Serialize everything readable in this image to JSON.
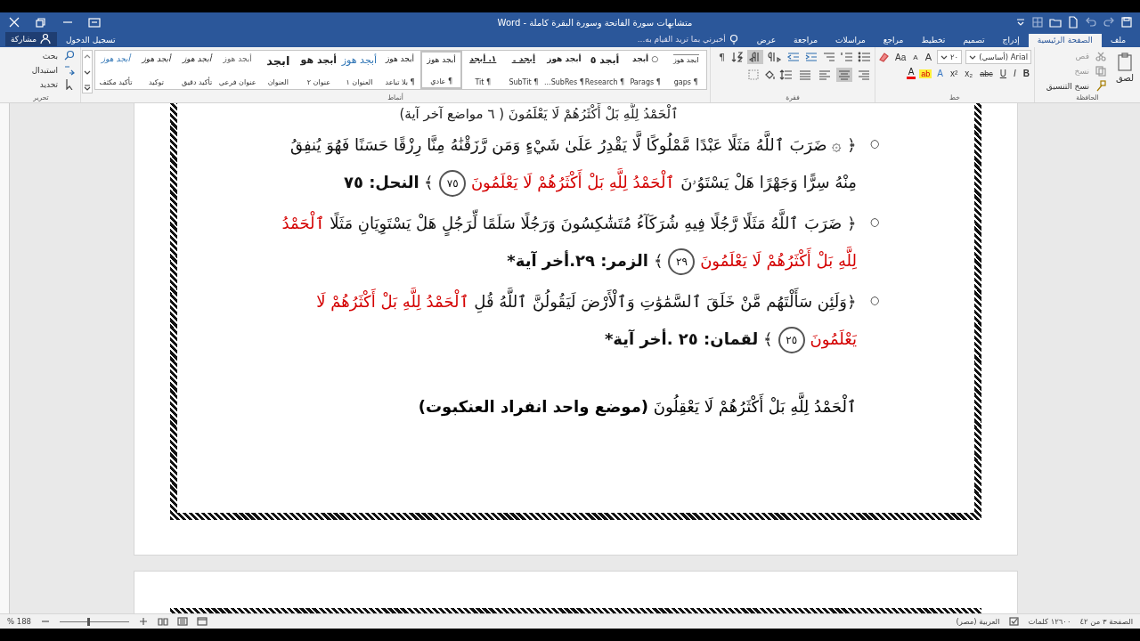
{
  "title_bar": {
    "title": "متشابهات سورة الفاتحة وسورة البقرة كاملة - Word"
  },
  "tabs": [
    {
      "label": "ملف",
      "selected": false
    },
    {
      "label": "الصفحة الرئيسية",
      "selected": true
    },
    {
      "label": "إدراج",
      "selected": false
    },
    {
      "label": "تصميم",
      "selected": false
    },
    {
      "label": "تخطيط",
      "selected": false
    },
    {
      "label": "مراجع",
      "selected": false
    },
    {
      "label": "مراسلات",
      "selected": false
    },
    {
      "label": "مراجعة",
      "selected": false
    },
    {
      "label": "عرض",
      "selected": false
    }
  ],
  "tell_me": {
    "placeholder": "أخبرني بما تريد القيام به..."
  },
  "account": {
    "sign_in": "تسجيل الدخول",
    "share": "مشاركة"
  },
  "ribbon": {
    "clipboard": {
      "label": "الحافظة",
      "paste": "لصق",
      "cut": "قص",
      "copy": "نسخ",
      "format_painter": "نسخ التنسيق"
    },
    "font": {
      "label": "خط",
      "font_name": "Arial (أساسي)",
      "font_size": "٢٠",
      "top_buttons": [
        {
          "label": "A",
          "kind": "grow"
        },
        {
          "label": "A",
          "kind": "shrink"
        },
        {
          "label": "Aa",
          "kind": "case"
        }
      ],
      "bottom_buttons": [
        {
          "label": "B",
          "kind": "bold"
        },
        {
          "label": "I",
          "kind": "italic"
        },
        {
          "label": "U",
          "kind": "underline"
        },
        {
          "label": "abc",
          "kind": "strike"
        },
        {
          "label": "x₂",
          "kind": "plain"
        },
        {
          "label": "x²",
          "kind": "plain"
        },
        {
          "label": "A",
          "kind": "effects"
        },
        {
          "label": "ab",
          "kind": "highlight"
        },
        {
          "label": "A",
          "kind": "color"
        }
      ]
    },
    "paragraph": {
      "label": "فقرة",
      "pilcrow": "¶",
      "direction": [
        {
          "kind": "ltr",
          "selected": false
        },
        {
          "kind": "rtl",
          "selected": true
        }
      ],
      "alignment": [
        {
          "kind": "right",
          "selected": false
        },
        {
          "kind": "center",
          "selected": true
        },
        {
          "kind": "left",
          "selected": false
        },
        {
          "kind": "justify",
          "selected": false
        }
      ]
    },
    "styles": {
      "label": "أنماط",
      "items": [
        {
          "preview": "ابجد هوز",
          "name": "¶ gaps",
          "kind": "tiny",
          "selected": false
        },
        {
          "preview": "○ أبجد",
          "name": "¶ Parags",
          "kind": "bold",
          "selected": false
        },
        {
          "preview": "أبجد ٥",
          "name": "¶ Research",
          "kind": "heavy",
          "selected": false
        },
        {
          "preview": "أبجد هوز",
          "name": "¶ SubRes...",
          "kind": "bold",
          "selected": false
        },
        {
          "preview": "أبجد ۔",
          "name": "¶ SubTit",
          "kind": "underline",
          "selected": false
        },
        {
          "preview": "١. أبجد",
          "name": "¶ Tit",
          "kind": "underline",
          "selected": false
        },
        {
          "preview": "أبجد هوز",
          "name": "¶ عادي",
          "kind": "plain",
          "selected": true
        },
        {
          "preview": "أبجد هوز",
          "name": "¶ بلا تباعد",
          "kind": "plain",
          "selected": false
        },
        {
          "preview": "أبجد هوز",
          "name": "العنوان ١",
          "kind": "heading",
          "selected": false
        },
        {
          "preview": "أبجد هو",
          "name": "عنوان ٢",
          "kind": "heavy",
          "selected": false
        },
        {
          "preview": "ابجد",
          "name": "العنوان",
          "kind": "title",
          "selected": false
        },
        {
          "preview": "أبجد هوز",
          "name": "عنوان فرعي",
          "kind": "subtle",
          "selected": false
        },
        {
          "preview": "أبجد هوز",
          "name": "تأكيد دقيق",
          "kind": "italic",
          "selected": false
        },
        {
          "preview": "أبجد هوز",
          "name": "توكيد",
          "kind": "italic",
          "selected": false
        },
        {
          "preview": "أبجد هوز",
          "name": "تأكيد مكثف",
          "kind": "intense",
          "selected": false
        }
      ]
    },
    "editing": {
      "label": "تحرير",
      "find": "بحث",
      "replace": "استبدال",
      "select": "تحديد"
    }
  },
  "document": {
    "top_line": "ٱلْحَمْدُ لِلَّهِ بَلْ أَكْثَرُهُمْ لَا يَعْلَمُونَ ( ٦ مواضع آخر آية)",
    "items": [
      {
        "bullet": "○",
        "segments": [
          {
            "kind": "quran",
            "text": "﴿ ۞ ضَرَبَ ٱللَّهُ مَثَلًا عَبْدًا مَّمْلُوكًا لَّا يَقْدِرُ عَلَىٰ شَيْءٍ وَمَن رَّزَقْنَٰهُ مِنَّا رِزْقًا حَسَنًا فَهُوَ يُنفِقُ مِنْهُ سِرًّا وَجَهْرًا هَلْ يَسْتَوُۥنَ"
          },
          {
            "kind": "highlight",
            "text": "ٱلْحَمْدُ لِلَّهِ بَلْ أَكْثَرُهُمْ لَا يَعْلَمُونَ"
          },
          {
            "kind": "ayah_number",
            "text": "٧٥"
          },
          {
            "kind": "quran",
            "text": "﴾"
          },
          {
            "kind": "reference",
            "text": "النحل: ٧٥"
          }
        ]
      },
      {
        "bullet": "○",
        "segments": [
          {
            "kind": "quran",
            "text": "﴿ ضَرَبَ ٱللَّهُ مَثَلًا رَّجُلًا فِيهِ شُرَكَآءُ مُتَشَٰكِسُونَ وَرَجُلًا سَلَمًا لِّرَجُلٍ هَلْ يَسْتَوِيَانِ مَثَلًا"
          },
          {
            "kind": "highlight",
            "text": "ٱلْحَمْدُ لِلَّهِ بَلْ أَكْثَرُهُمْ لَا يَعْلَمُونَ"
          },
          {
            "kind": "ayah_number",
            "text": "٢٩"
          },
          {
            "kind": "quran",
            "text": "﴾"
          },
          {
            "kind": "reference",
            "text": "الزمر: ٢٩.أخر آية*"
          }
        ]
      },
      {
        "bullet": "○",
        "segments": [
          {
            "kind": "quran",
            "text": "﴿وَلَئِن سَأَلْتَهُم مَّنْ خَلَقَ ٱلسَّمَٰوَٰتِ وَٱلْأَرْضَ لَيَقُولُنَّ ٱللَّهُ قُلِ"
          },
          {
            "kind": "highlight",
            "text": "ٱلْحَمْدُ لِلَّهِ بَلْ أَكْثَرُهُمْ لَا يَعْلَمُونَ"
          },
          {
            "kind": "ayah_number",
            "text": "٢٥"
          },
          {
            "kind": "quran",
            "text": "﴾"
          },
          {
            "kind": "reference",
            "text": "لقمان: ٢٥ .أخر آية*"
          }
        ]
      }
    ],
    "closing": {
      "verse": "ٱلْحَمْدُ لِلَّهِ بَلْ أَكْثَرُهُمْ لَا يَعْقِلُونَ",
      "note": "(موضع واحد انفراد العنكبوت)"
    }
  },
  "status_bar": {
    "page": "الصفحة ٣ من ٤٢",
    "words": "١٢٦٠٠ كلمات",
    "language": "العربية (مصر)",
    "zoom": "188 %",
    "zoom_slider": {
      "level": 0.4
    }
  }
}
